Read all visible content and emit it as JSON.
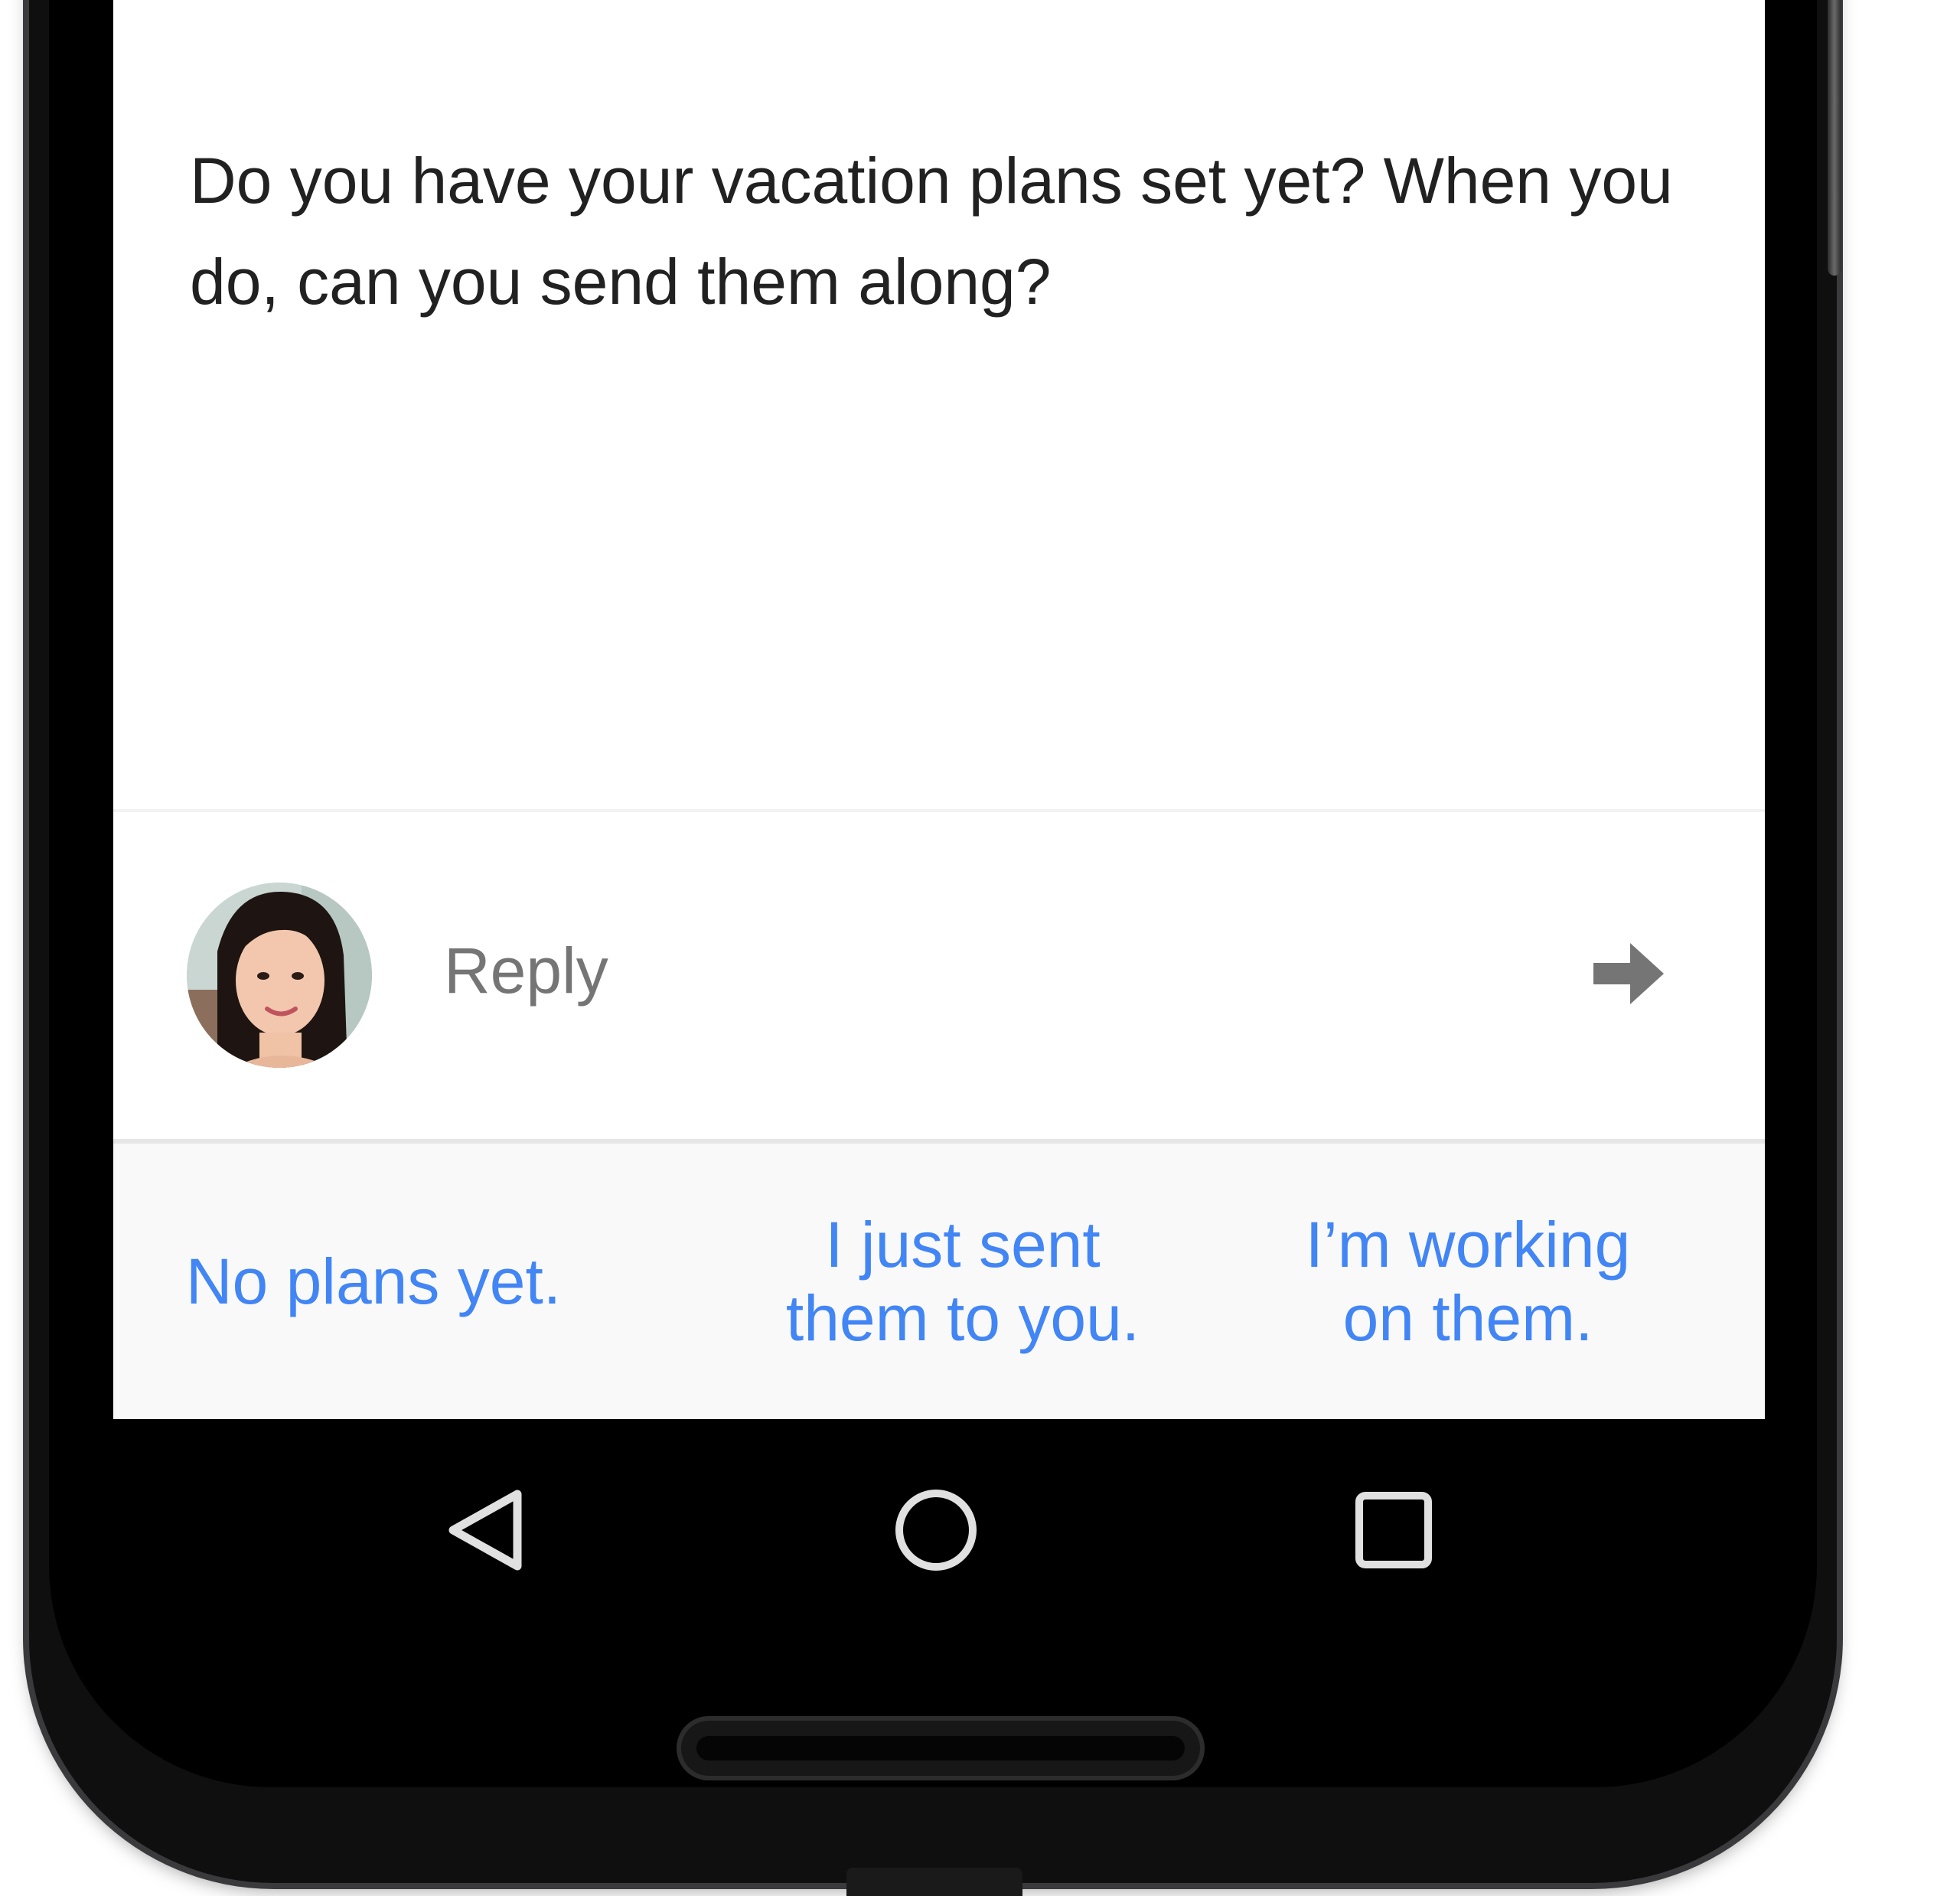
{
  "message": {
    "body": "Do you have your vacation plans set yet? When you do, can you send them along?"
  },
  "reply": {
    "avatar_icon": "avatar",
    "placeholder": "Reply",
    "send_icon": "arrow-right-icon"
  },
  "smart_replies": [
    {
      "label": "No plans yet."
    },
    {
      "label": "I just sent\nthem to you."
    },
    {
      "label": "I’m working\non them."
    }
  ],
  "navbar": {
    "back_icon": "back-triangle-icon",
    "home_icon": "home-circle-icon",
    "recent_icon": "recent-apps-square-icon"
  },
  "colors": {
    "accent": "#4285f4",
    "message_text": "#212121",
    "placeholder_text": "#757575",
    "suggestion_bg": "#f9f9f9",
    "navbar_bg": "#000000"
  }
}
